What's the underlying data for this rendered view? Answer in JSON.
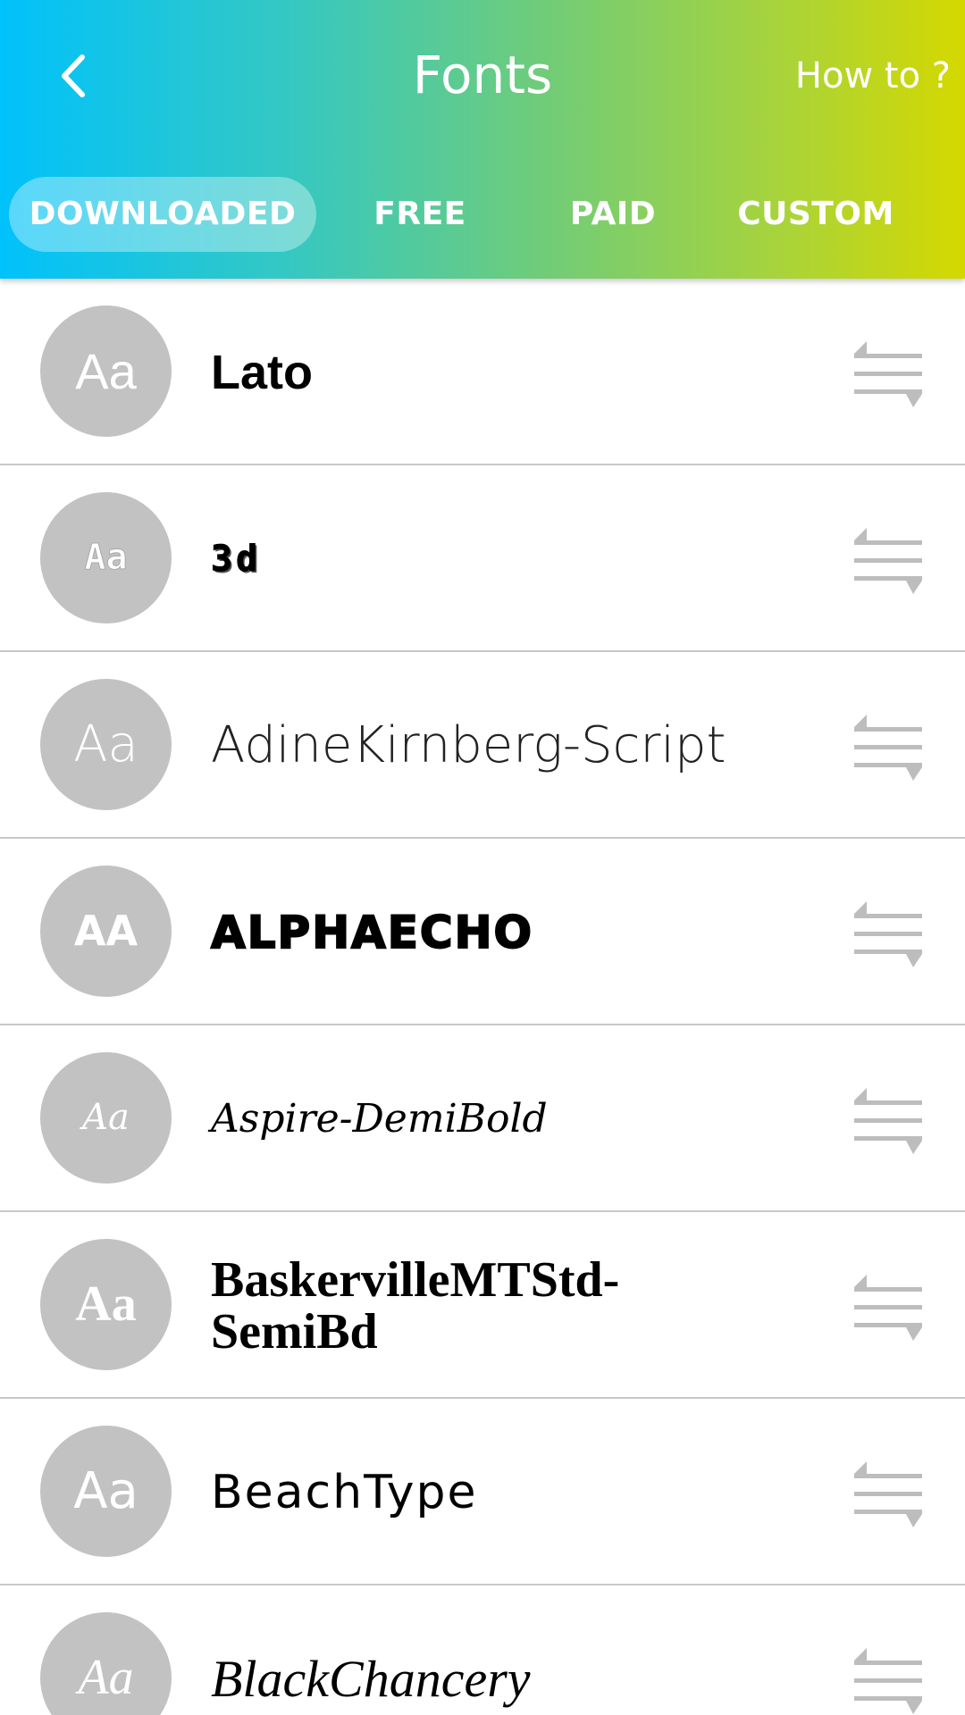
{
  "header": {
    "title": "Fonts",
    "how_to_label": "How to ?"
  },
  "tabs": [
    {
      "label": "DOWNLOADED",
      "active": true
    },
    {
      "label": "FREE",
      "active": false
    },
    {
      "label": "PAID",
      "active": false
    },
    {
      "label": "CUSTOM",
      "active": false
    }
  ],
  "fonts": [
    {
      "avatar": "Aa",
      "name": "Lato"
    },
    {
      "avatar": "Aa",
      "name": "3d"
    },
    {
      "avatar": "Aa",
      "name": "AdineKirnberg-Script"
    },
    {
      "avatar": "AA",
      "name": "ALPHAECHO"
    },
    {
      "avatar": "Aa",
      "name": "Aspire-DemiBold"
    },
    {
      "avatar": "Aa",
      "name": "BaskervilleMTStd-SemiBd"
    },
    {
      "avatar": "Aa",
      "name": "BeachType"
    },
    {
      "avatar": "Aa",
      "name": "BlackChancery"
    }
  ],
  "icons": {
    "back": "chevron-left-icon",
    "reorder": "reorder-icon"
  },
  "colors": {
    "gradient_start": "#00c2fb",
    "gradient_end": "#d5d800",
    "avatar_bg": "#c2c2c2",
    "divider": "#c8c8c8",
    "reorder_icon": "#bdbdbd"
  }
}
